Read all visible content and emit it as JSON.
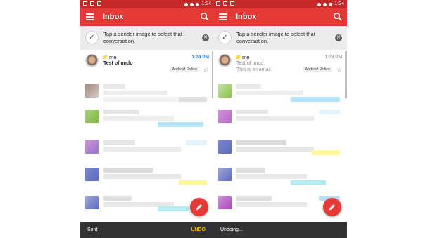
{
  "screens": [
    {
      "status_time": "1:24",
      "title": "Inbox",
      "tip": {
        "text": "Tap a sender image to select that conversation."
      },
      "email": {
        "sender": "me",
        "subject": "Test of undo",
        "preview": "",
        "time": "1:24 PM",
        "label": "Android Police"
      },
      "snackbar": {
        "message": "Sent",
        "action": "UNDO"
      }
    },
    {
      "status_time": "1:24",
      "title": "Inbox",
      "tip": {
        "text": "Tap a sender image to select that conversation."
      },
      "email": {
        "sender": "me",
        "subject": "Test of undo",
        "preview": "This is an email.",
        "time": "1:23 PM",
        "label": "Android Police"
      },
      "snackbar": {
        "message": "Undoing...",
        "action": ""
      }
    }
  ],
  "colors": {
    "accent": "#e53935",
    "status_bar": "#c62828",
    "unread_time": "#1e88e5",
    "snackbar_action": "#ffb300"
  },
  "icons": [
    "menu-icon",
    "search-icon",
    "check-icon",
    "close-icon",
    "star-icon",
    "pencil-icon"
  ]
}
